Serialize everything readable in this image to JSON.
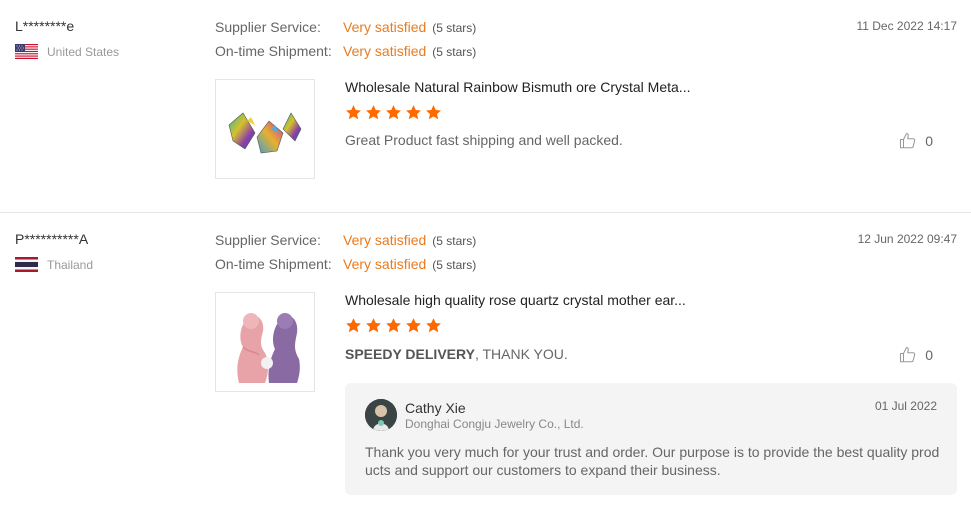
{
  "reviews": [
    {
      "user": "L********e",
      "country": "United States",
      "flag_icon": "us-flag-icon",
      "supplier_service_label": "Supplier Service:",
      "supplier_service_value": "Very satisfied",
      "supplier_service_stars": "(5 stars)",
      "shipment_label": "On-time Shipment:",
      "shipment_value": "Very satisfied",
      "shipment_stars": "(5 stars)",
      "date": "11 Dec 2022 14:17",
      "product_title": "Wholesale Natural Rainbow Bismuth ore Crystal Meta...",
      "rating": 5,
      "comment": "Great Product fast shipping and well packed.",
      "likes": "0"
    },
    {
      "user": "P**********A",
      "country": "Thailand",
      "flag_icon": "thailand-flag-icon",
      "supplier_service_label": "Supplier Service:",
      "supplier_service_value": "Very satisfied",
      "supplier_service_stars": "(5 stars)",
      "shipment_label": "On-time Shipment:",
      "shipment_value": "Very satisfied",
      "shipment_stars": "(5 stars)",
      "date": "12 Jun 2022 09:47",
      "product_title": "Wholesale high quality rose quartz crystal mother ear...",
      "rating": 5,
      "comment_bold": "SPEEDY DELIVERY",
      "comment_rest": ", THANK YOU.",
      "likes": "0",
      "reply": {
        "name": "Cathy Xie",
        "company": "Donghai Congju Jewelry Co., Ltd.",
        "date": "01 Jul 2022",
        "text": "Thank you very much for your trust and order. Our purpose is to provide the best quality products and support our customers to expand their business."
      }
    }
  ],
  "colors": {
    "accent": "#e97a1e",
    "star": "#ff6a00",
    "divider": "#e5e5e5",
    "reply_bg": "#f4f4f4"
  }
}
